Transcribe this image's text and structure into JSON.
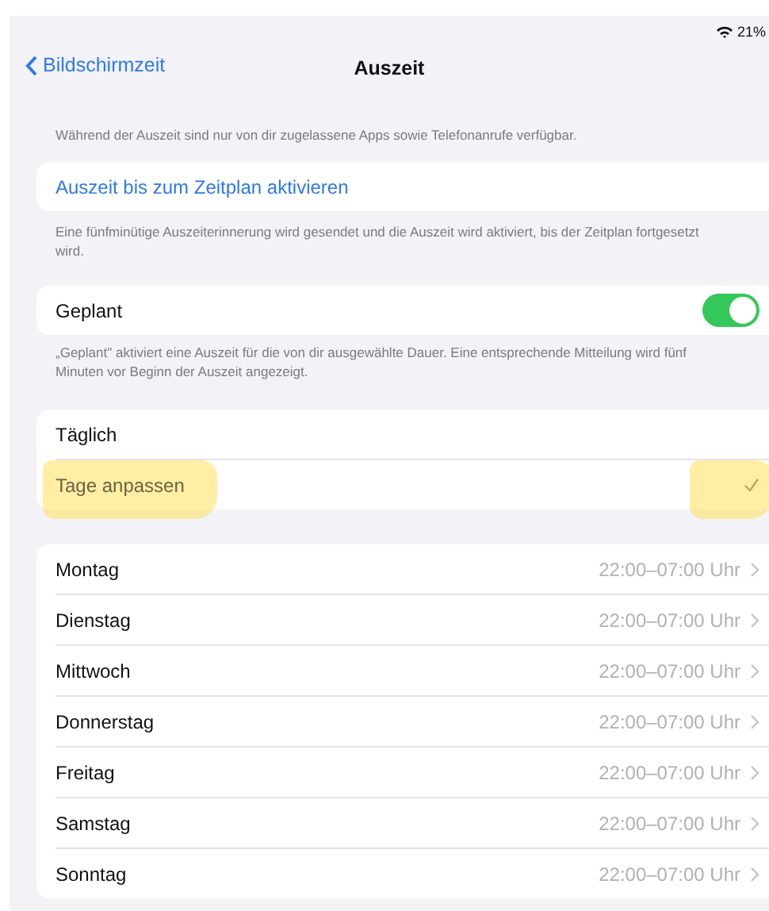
{
  "status_bar": {
    "battery": "21%"
  },
  "nav": {
    "back": "Bildschirmzeit",
    "title": "Auszeit"
  },
  "intro": "Während der Auszeit sind nur von dir zugelassene Apps sowie Telefonanrufe verfügbar.",
  "activate": {
    "label": "Auszeit bis zum Zeitplan aktivieren",
    "note": "Eine fünfminütige Auszeiterinnerung wird gesendet und die Auszeit wird aktiviert, bis der Zeitplan fortgesetzt wird."
  },
  "scheduled": {
    "label": "Geplant",
    "on": true,
    "note": "„Geplant\" aktiviert eine Auszeit für die von dir ausgewählte Dauer. Eine entsprechende Mitteilung wird fünf Minuten vor Beginn der Auszeit angezeigt."
  },
  "options": [
    {
      "label": "Täglich",
      "selected": false,
      "highlighted": false
    },
    {
      "label": "Tage anpassen",
      "selected": true,
      "highlighted": true
    }
  ],
  "days": [
    {
      "label": "Montag",
      "value": "22:00–07:00 Uhr"
    },
    {
      "label": "Dienstag",
      "value": "22:00–07:00 Uhr"
    },
    {
      "label": "Mittwoch",
      "value": "22:00–07:00 Uhr"
    },
    {
      "label": "Donnerstag",
      "value": "22:00–07:00 Uhr"
    },
    {
      "label": "Freitag",
      "value": "22:00–07:00 Uhr"
    },
    {
      "label": "Samstag",
      "value": "22:00–07:00 Uhr"
    },
    {
      "label": "Sonntag",
      "value": "22:00–07:00 Uhr"
    }
  ]
}
